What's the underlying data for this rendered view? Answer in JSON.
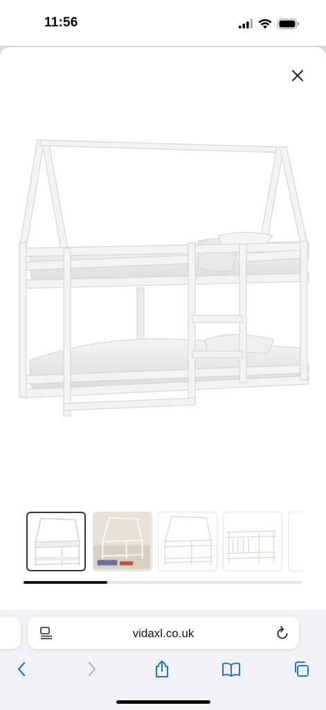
{
  "status_bar": {
    "time": "11:56",
    "icons": [
      "signal-icon",
      "wifi-icon",
      "battery-icon"
    ]
  },
  "modal": {
    "close_icon": "close-icon",
    "hero_image": "bunk-bed-white-house-frame",
    "thumbnails": [
      {
        "name": "thumbnail-1",
        "image": "bunk-bed-front-view",
        "selected": true
      },
      {
        "name": "thumbnail-2",
        "image": "bunk-bed-room-scene",
        "selected": false
      },
      {
        "name": "thumbnail-3",
        "image": "bunk-bed-without-mattress",
        "selected": false
      },
      {
        "name": "thumbnail-4",
        "image": "bunk-bed-slats-view",
        "selected": false
      },
      {
        "name": "thumbnail-5",
        "image": "bunk-bed-partial",
        "selected": false
      }
    ],
    "carousel_progress": 0.3
  },
  "browser": {
    "url": "vidaxl.co.uk",
    "toolbar": [
      "back-icon",
      "forward-icon",
      "share-icon",
      "bookmarks-icon",
      "tabs-icon"
    ]
  },
  "colors": {
    "accent": "#1a73e8",
    "disabled": "#b8b8be",
    "frame": "#f2f2f0"
  }
}
